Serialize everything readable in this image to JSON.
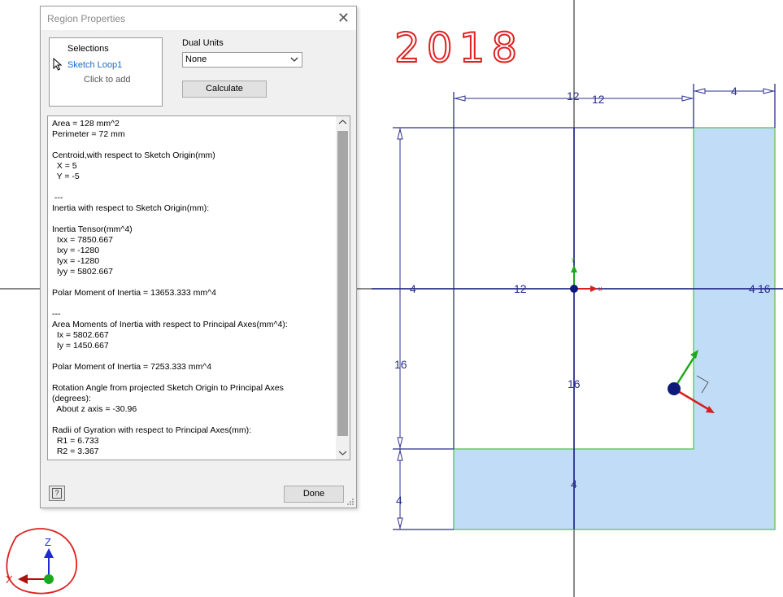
{
  "annotation": {
    "handwritten_year": "2018"
  },
  "dialog": {
    "title": "Region Properties",
    "close_glyph": "✕",
    "selections": {
      "header": "Selections",
      "item": "Sketch Loop1",
      "click_to_add": "Click to add"
    },
    "dual_units": {
      "label": "Dual Units",
      "value": "None"
    },
    "calculate_label": "Calculate",
    "results_text": "Area = 128 mm^2\nPerimeter = 72 mm\n\nCentroid,with respect to Sketch Origin(mm)\n  X = 5\n  Y = -5\n\n ---\nInertia with respect to Sketch Origin(mm):\n\nInertia Tensor(mm^4)\n  Ixx = 7850.667\n  Ixy = -1280\n  Iyx = -1280\n  Iyy = 5802.667\n\nPolar Moment of Inertia = 13653.333 mm^4\n\n---\nArea Moments of Inertia with respect to Principal Axes(mm^4):\n  Ix = 5802.667\n  Iy = 1450.667\n\nPolar Moment of Inertia = 7253.333 mm^4\n\nRotation Angle from projected Sketch Origin to Principal Axes\n(degrees):\n  About z axis = -30.96\n\nRadii of Gyration with respect to Principal Axes(mm):\n  R1 = 6.733\n  R2 = 3.367",
    "done_label": "Done",
    "help_glyph": "?"
  },
  "sketch": {
    "dimensions": {
      "top_left": "12",
      "top_right": "12",
      "top_small": "4",
      "left_upper": "16",
      "left_lower": "4",
      "axis_left": "4",
      "axis_mid": "12",
      "axis_right_a": "4",
      "axis_right_b": "16",
      "center_vertical": "16",
      "bottom_center": "4"
    },
    "axis_x_label": "x",
    "axis_y_label": "y",
    "region_fill_color": "#c0dcf7",
    "region_edge_color": "#6ec86e",
    "dimension_color": "#2a2f8c"
  },
  "view_triad": {
    "z_label": "Z",
    "x_label": "X"
  }
}
